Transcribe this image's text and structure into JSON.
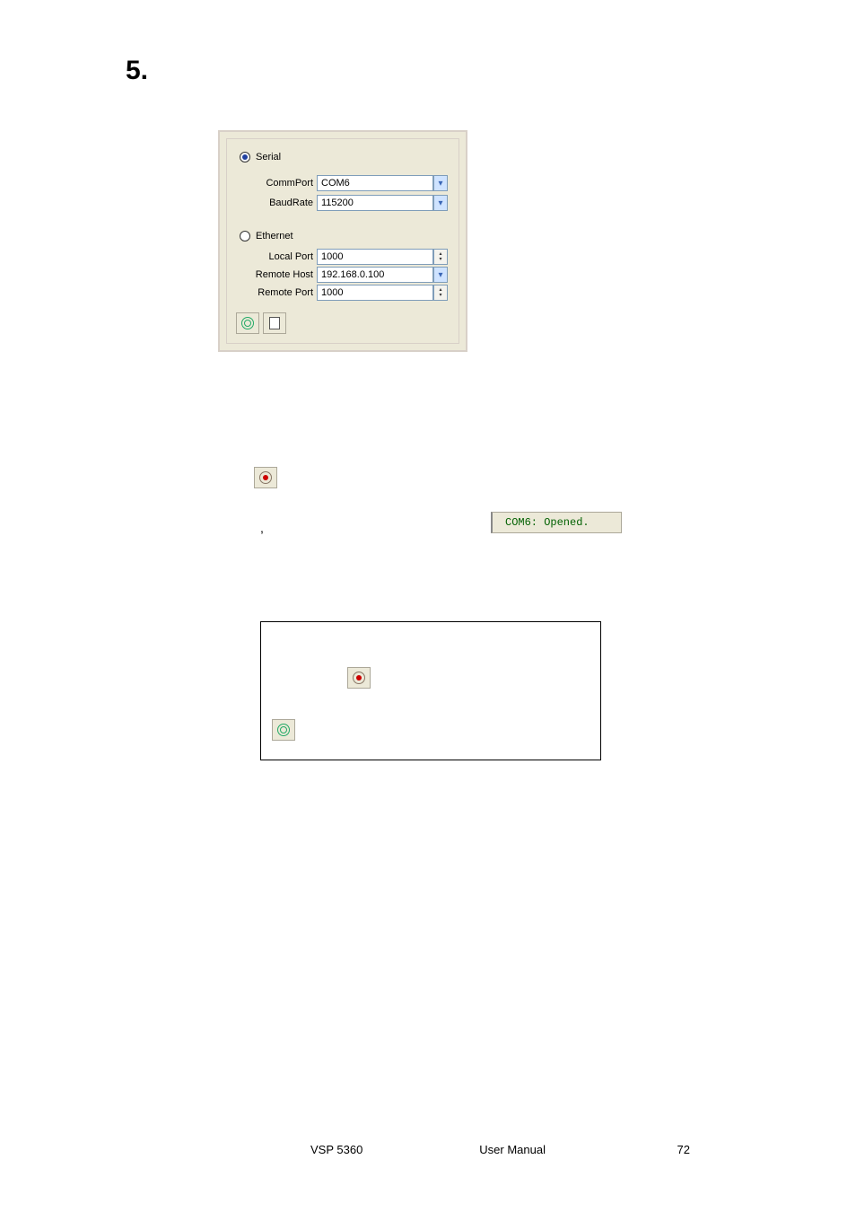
{
  "section_number": "5.",
  "panel": {
    "serial_label": "Serial",
    "ethernet_label": "Ethernet",
    "commport_label": "CommPort",
    "commport_value": "COM6",
    "baudrate_label": "BaudRate",
    "baudrate_value": "115200",
    "localport_label": "Local Port",
    "localport_value": "1000",
    "remotehost_label": "Remote Host",
    "remotehost_value": "192.168.0.100",
    "remoteport_label": "Remote Port",
    "remoteport_value": "1000"
  },
  "status_text": "COM6: Opened.",
  "comma": ",",
  "footer": {
    "product": "VSP 5360",
    "doc": "User Manual",
    "page": "72"
  }
}
